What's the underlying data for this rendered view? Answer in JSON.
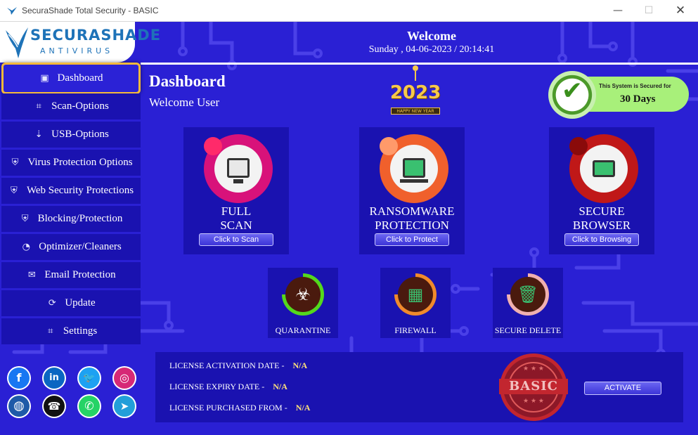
{
  "window": {
    "title": "SecuraShade Total Security - BASIC",
    "controls": {
      "minimize": "—",
      "maximize": "☐",
      "close": "✕"
    }
  },
  "logo": {
    "brand": "SECURASHADE",
    "sub": "ANTIVIRUS"
  },
  "header": {
    "welcome": "Welcome",
    "datetime": "Sunday , 04-06-2023 / 20:14:41"
  },
  "sidebar": {
    "items": [
      {
        "label": "Dashboard",
        "icon": "monitor-icon",
        "glyph": "▣",
        "active": true
      },
      {
        "label": "Scan-Options",
        "icon": "scan-icon",
        "glyph": "⌗"
      },
      {
        "label": "USB-Options",
        "icon": "usb-icon",
        "glyph": "⇣"
      },
      {
        "label": "Virus Protection Options",
        "icon": "shield-virus-icon",
        "glyph": "⛨"
      },
      {
        "label": "Web Security Protections",
        "icon": "lock-shield-icon",
        "glyph": "⛨"
      },
      {
        "label": "Blocking/Protection",
        "icon": "block-shield-icon",
        "glyph": "⛨"
      },
      {
        "label": "Optimizer/Cleaners",
        "icon": "gauge-icon",
        "glyph": "◔"
      },
      {
        "label": "Email Protection",
        "icon": "email-icon",
        "glyph": "✉"
      },
      {
        "label": "Update",
        "icon": "refresh-icon",
        "glyph": "⟳"
      },
      {
        "label": "Settings",
        "icon": "settings-icon",
        "glyph": "⌗"
      }
    ]
  },
  "dashboard": {
    "title": "Dashboard",
    "subtitle": "Welcome User"
  },
  "new_year": {
    "year": "2023",
    "caption": "HAPPY NEW YEAR"
  },
  "secured": {
    "text": "This System is Secured for",
    "days": "30 Days"
  },
  "cards": [
    {
      "name_line1": "FULL",
      "name_line2": "SCAN",
      "button": "Click to Scan",
      "ring_color": "#d8127a",
      "dot_color": "#ff2a6a",
      "icon": "monitor-scan-icon"
    },
    {
      "name_line1": "RANSOMWARE",
      "name_line2": "PROTECTION",
      "button": "Click to Protect",
      "ring_color": "#f0602c",
      "dot_color": "#ff9a6a",
      "icon": "laptop-lock-icon"
    },
    {
      "name_line1": "SECURE",
      "name_line2": "BROWSER",
      "button": "Click to Browsing",
      "ring_color": "#c01818",
      "dot_color": "#8a0a0a",
      "icon": "browser-shield-icon"
    }
  ],
  "small_cards": [
    {
      "name": "QUARANTINE",
      "icon": "biohazard-icon",
      "glyph": "☣",
      "ring_color": "#54d81c",
      "glyph_color": "#ffffff"
    },
    {
      "name": "FIREWALL",
      "icon": "firewall-icon",
      "glyph": "▦",
      "ring_color": "#f08a2c",
      "glyph_color": "#3ac070"
    },
    {
      "name": "SECURE DELETE",
      "icon": "trash-icon",
      "glyph": "🗑",
      "ring_color": "#f0b0b0",
      "glyph_color": "#3ac070"
    }
  ],
  "license": {
    "activation_label": "LICENSE ACTIVATION DATE -",
    "activation_value": "N/A",
    "expiry_label": "LICENSE EXPIRY DATE -",
    "expiry_value": "N/A",
    "purchased_label": "LICENSE PURCHASED FROM -",
    "purchased_value": "N/A",
    "stamp_text": "BASIC",
    "activate_button": "ACTIVATE"
  },
  "social": [
    {
      "icon": "facebook-icon",
      "glyph": "f",
      "color": "#1877f2"
    },
    {
      "icon": "linkedin-icon",
      "glyph": "in",
      "color": "#0a66c2"
    },
    {
      "icon": "twitter-icon",
      "glyph": "🐦",
      "color": "#1da1f2"
    },
    {
      "icon": "instagram-icon",
      "glyph": "◎",
      "color": "#d62976"
    },
    {
      "icon": "globe-icon",
      "glyph": "◍",
      "color": "#1e5aa8"
    },
    {
      "icon": "toll-free-icon",
      "glyph": "☎",
      "color": "#111111"
    },
    {
      "icon": "whatsapp-icon",
      "glyph": "✆",
      "color": "#25d366"
    },
    {
      "icon": "telegram-icon",
      "glyph": "➤",
      "color": "#229ed9"
    }
  ],
  "colors": {
    "accent": "#2a20d4",
    "panel": "#1a12b0",
    "active_border": "#f4b93a"
  }
}
